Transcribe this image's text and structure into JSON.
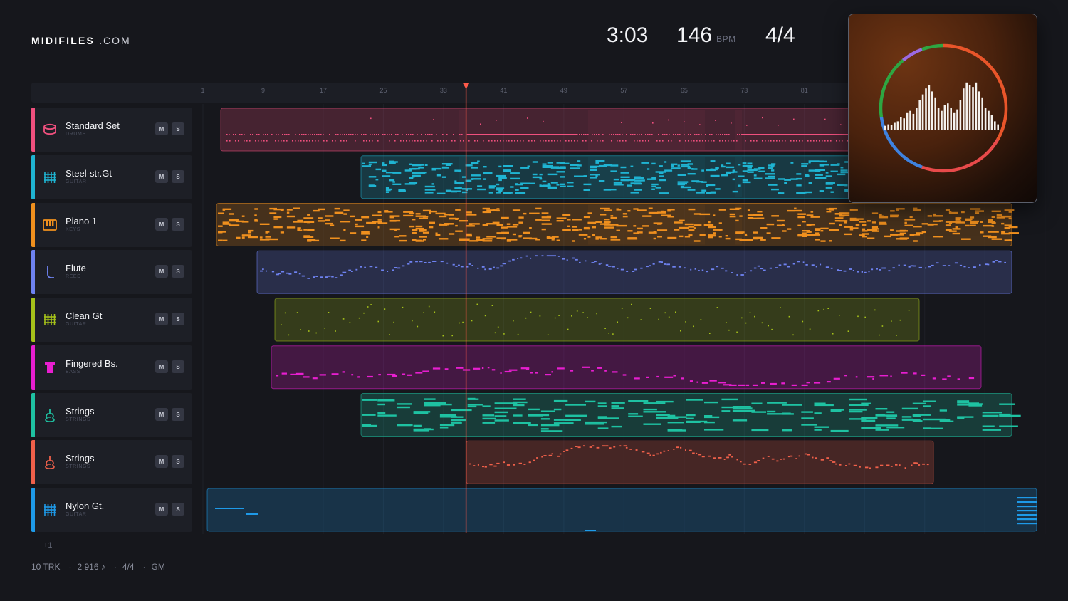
{
  "brand": {
    "bold": "MIDIFILES",
    "light": ".COM"
  },
  "transport": {
    "time": "3:03",
    "tempo": "146",
    "tempo_unit": "BPM",
    "meter": "4/4"
  },
  "ruler": {
    "ticks": [
      "1",
      "9",
      "17",
      "25",
      "33",
      "41",
      "49",
      "57",
      "65",
      "73",
      "81"
    ]
  },
  "playhead_bar": 36,
  "colors": {
    "playhead": "#ff5a4a",
    "background": "#16171c"
  },
  "tracks": [
    {
      "name": "Standard Set",
      "category": "DRUMS",
      "icon": "drum-icon",
      "color": "#f0507e",
      "mute": "M",
      "solo": "S"
    },
    {
      "name": "Steel-str.Gt",
      "category": "GUITAR",
      "icon": "guitar-fret-icon",
      "color": "#1fb4d2",
      "mute": "M",
      "solo": "S"
    },
    {
      "name": "Piano 1",
      "category": "KEYS",
      "icon": "keyboard-icon",
      "color": "#f0901e",
      "mute": "M",
      "solo": "S"
    },
    {
      "name": "Flute",
      "category": "REED",
      "icon": "flute-icon",
      "color": "#6e82f0",
      "mute": "M",
      "solo": "S"
    },
    {
      "name": "Clean Gt",
      "category": "GUITAR",
      "icon": "guitar-fret-icon",
      "color": "#a6c21a",
      "mute": "M",
      "solo": "S"
    },
    {
      "name": "Fingered Bs.",
      "category": "BASS",
      "icon": "bass-icon",
      "color": "#e81ed0",
      "mute": "M",
      "solo": "S"
    },
    {
      "name": "Strings",
      "category": "STRINGS",
      "icon": "violin-icon",
      "color": "#1ec2a2",
      "mute": "M",
      "solo": "S"
    },
    {
      "name": "Strings",
      "category": "STRINGS",
      "icon": "violin-icon",
      "color": "#f0604a",
      "mute": "M",
      "solo": "S"
    },
    {
      "name": "Nylon Gt.",
      "category": "GUITAR",
      "icon": "guitar-fret-icon",
      "color": "#1e9ae8",
      "mute": "M",
      "solo": "S"
    }
  ],
  "footer": {
    "more_tracks": "+1",
    "track_count": "10 TRK",
    "note_count": "2 916 ♪",
    "meter": "4/4",
    "standard": "GM",
    "separator": "·"
  }
}
